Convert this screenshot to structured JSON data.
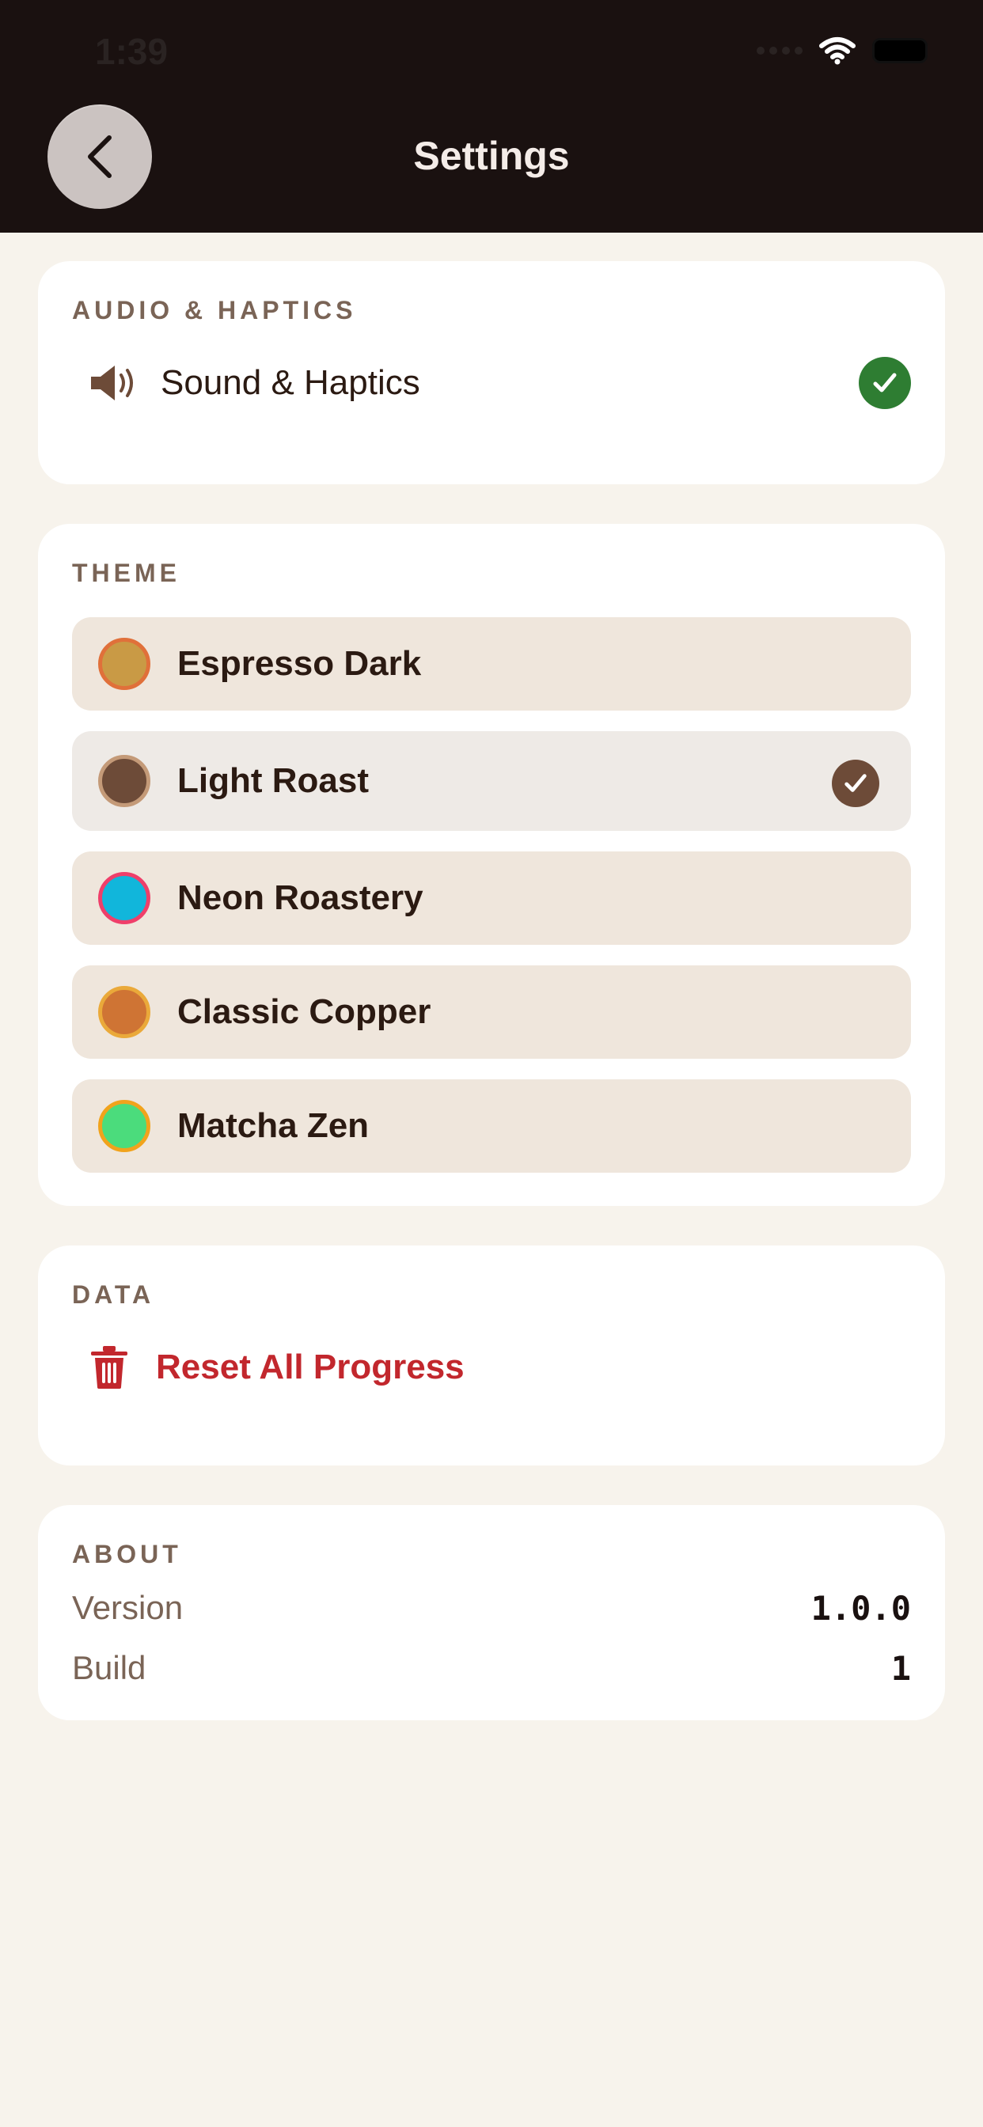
{
  "status_bar": {
    "time": "1:39"
  },
  "header": {
    "title": "Settings"
  },
  "audio": {
    "section_title": "AUDIO & HAPTICS",
    "sound_label": "Sound & Haptics",
    "enabled": true
  },
  "theme": {
    "section_title": "THEME",
    "items": [
      {
        "label": "Espresso Dark",
        "fill": "#c99a45",
        "ring": "#e0703a",
        "selected": false
      },
      {
        "label": "Light Roast",
        "fill": "#6d4b38",
        "ring": "#c49a78",
        "selected": true
      },
      {
        "label": "Neon Roastery",
        "fill": "#11b6db",
        "ring": "#ef3f6a",
        "selected": false
      },
      {
        "label": "Classic Copper",
        "fill": "#cf7434",
        "ring": "#eaa93a",
        "selected": false
      },
      {
        "label": "Matcha Zen",
        "fill": "#4bdc7c",
        "ring": "#f1a31c",
        "selected": false
      }
    ]
  },
  "data_section": {
    "section_title": "DATA",
    "reset_label": "Reset All Progress",
    "reset_color": "#c2272d"
  },
  "about": {
    "section_title": "ABOUT",
    "version_label": "Version",
    "version_value": "1.0.0",
    "build_label": "Build",
    "build_value": "1"
  },
  "colors": {
    "header_bg": "#1a1110",
    "page_bg": "#f7f3ec",
    "accent_green": "#2e7d32",
    "accent_brown": "#6d4b38"
  }
}
